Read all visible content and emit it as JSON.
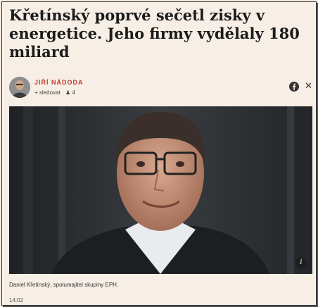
{
  "article": {
    "headline": "Křetínský poprvé sečetl zisky v energetice. Jeho firmy vydělaly 180 miliard",
    "author": "JIŘÍ NÁDODA",
    "follow_label": "+ sledovat",
    "followers_count": "4",
    "caption": "Daniel Křetínský, spolumajitel skupiny EPH.",
    "time": "14:02"
  },
  "icons": {
    "facebook": "facebook-icon",
    "x": "x-icon",
    "info": "info-icon",
    "followers": "person-icon"
  },
  "colors": {
    "background": "#f7efe6",
    "author_accent": "#c0392b"
  }
}
